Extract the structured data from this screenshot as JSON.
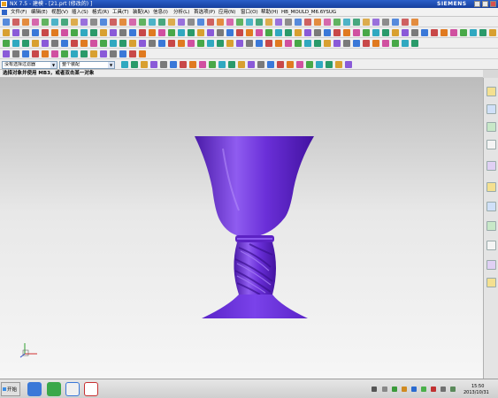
{
  "window": {
    "title": "NX 7.5 - 建模 - [21.prt  (修改的)  ]",
    "brand": "SIEMENS"
  },
  "menu": {
    "items": [
      "文件(F)",
      "编辑(E)",
      "视图(V)",
      "插入(S)",
      "格式(R)",
      "工具(T)",
      "装配(A)",
      "信息(I)",
      "分析(L)",
      "首选项(P)",
      "应用(N)",
      "窗口(O)",
      "帮助(H)",
      "HB_MOULD_M6.6",
      "YSUG"
    ]
  },
  "selection_bar": {
    "filter_value": "没有选择过滤器",
    "scope_value": "整个装配"
  },
  "cue_line": {
    "text": "选择对象并使用 MB3，或者双击某一对象"
  },
  "model": {
    "color": "#6a2fd8",
    "description_icon": "goblet-solid-model"
  },
  "taskbar": {
    "start_label": "开始",
    "clock_time": "15:50",
    "clock_date": "2013/10/31"
  },
  "colors": {
    "titlebar": "#1f4fb5",
    "model_purple": "#6a2fd8",
    "viewport_top": "#bcbcbc",
    "viewport_bottom": "#f6f6f6"
  }
}
